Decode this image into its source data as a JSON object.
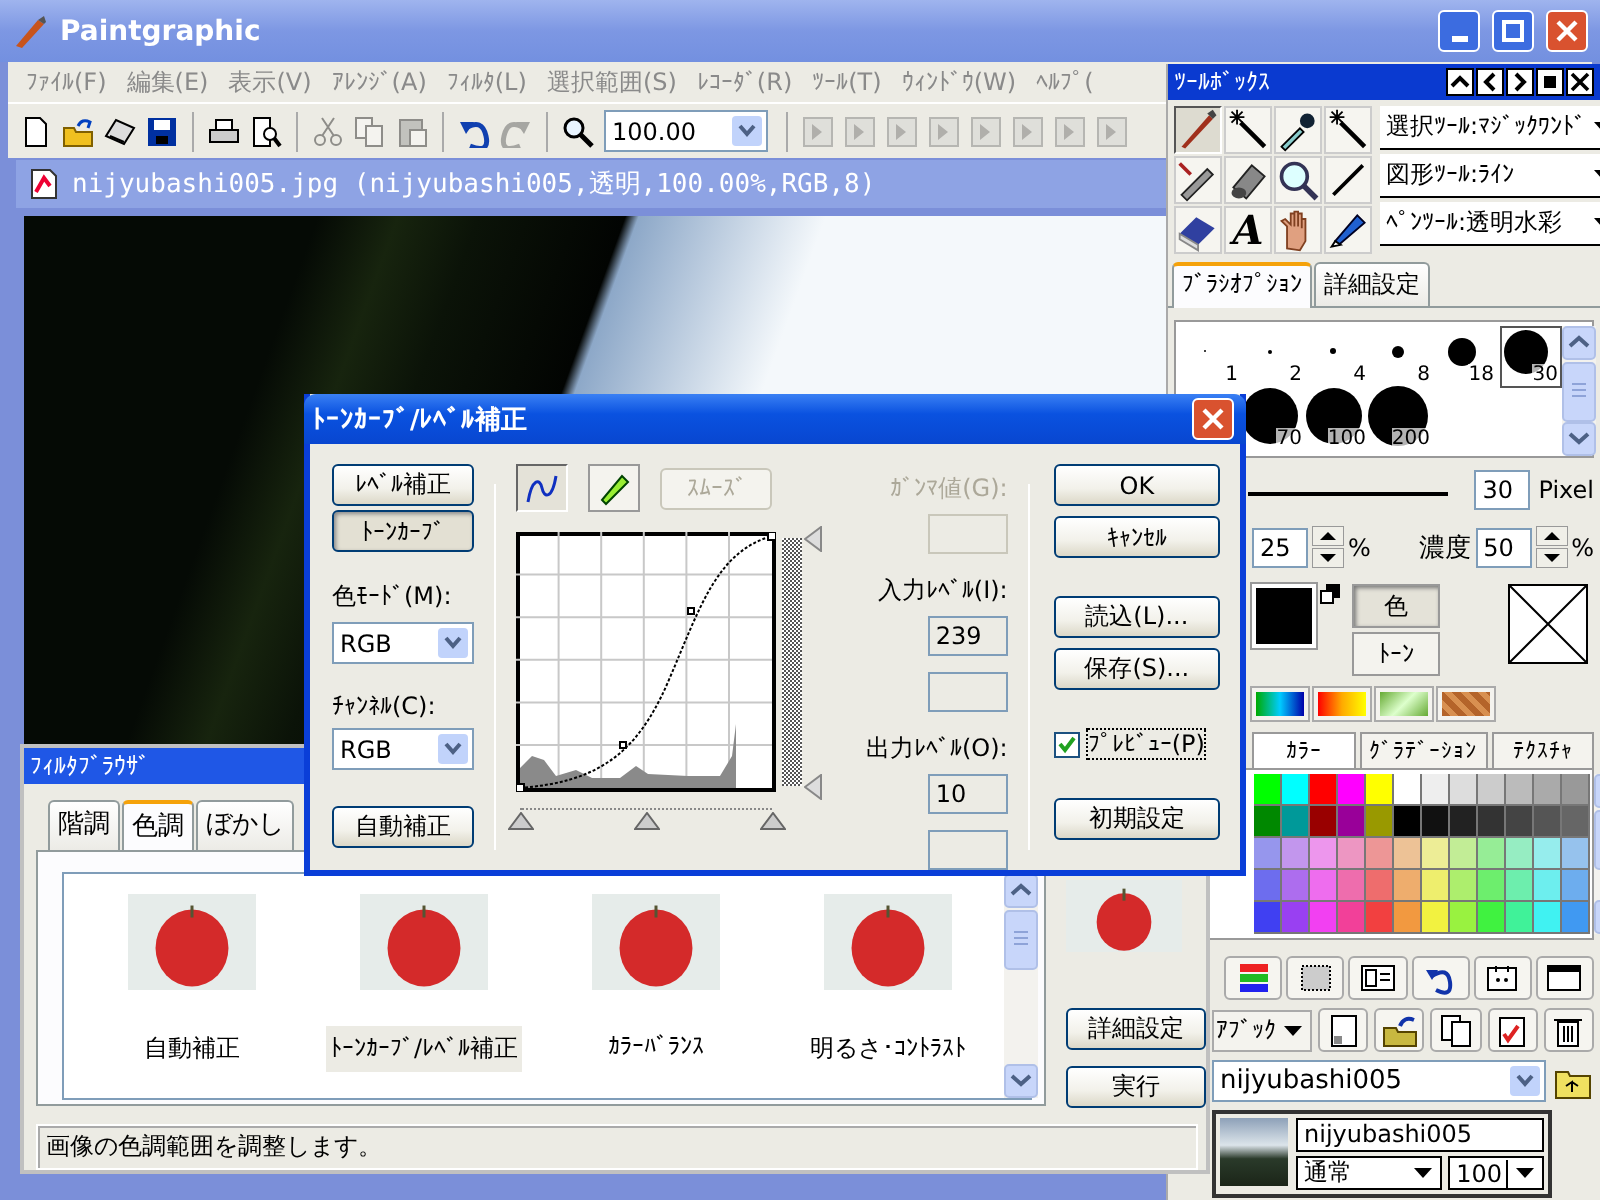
{
  "app": {
    "title": "Paintgraphic"
  },
  "menu": [
    "ﾌｧｲﾙ(F)",
    "編集(E)",
    "表示(V)",
    "ｱﾚﾝｼﾞ(A)",
    "ﾌｨﾙﾀ(L)",
    "選択範囲(S)",
    "ﾚｺｰﾀﾞ(R)",
    "ﾂｰﾙ(T)",
    "ｳｨﾝﾄﾞｳ(W)",
    "ﾍﾙﾌﾟ("
  ],
  "toolbar": {
    "zoom": "100.00",
    "buttons": [
      {
        "kind": "new-file",
        "disabled": false
      },
      {
        "kind": "open-folder",
        "disabled": false
      },
      {
        "kind": "scanner",
        "disabled": false
      },
      {
        "kind": "save",
        "disabled": false
      },
      {
        "kind": "sep"
      },
      {
        "kind": "printer",
        "disabled": false
      },
      {
        "kind": "print-preview",
        "disabled": false
      },
      {
        "kind": "sep"
      },
      {
        "kind": "scissors",
        "disabled": true
      },
      {
        "kind": "copy",
        "disabled": true
      },
      {
        "kind": "paste",
        "disabled": true
      },
      {
        "kind": "sep"
      },
      {
        "kind": "undo",
        "disabled": false
      },
      {
        "kind": "redo",
        "disabled": true
      },
      {
        "kind": "sep"
      },
      {
        "kind": "magnifier",
        "disabled": false
      },
      {
        "kind": "zoom"
      },
      {
        "kind": "sep"
      },
      {
        "kind": "arrange",
        "disabled": true
      },
      {
        "kind": "arrange",
        "disabled": true
      },
      {
        "kind": "arrange",
        "disabled": true
      },
      {
        "kind": "arrange",
        "disabled": true
      },
      {
        "kind": "arrange",
        "disabled": true
      },
      {
        "kind": "arrange",
        "disabled": true
      },
      {
        "kind": "arrange",
        "disabled": true
      },
      {
        "kind": "arrange",
        "disabled": true
      }
    ]
  },
  "document": {
    "title": "nijyubashi005.jpg (nijyubashi005,透明,100.00%,RGB,8)"
  },
  "toolbox": {
    "title": "ﾂｰﾙﾎﾞｯｸｽ",
    "tools": [
      {
        "kind": "brush",
        "selected": true
      },
      {
        "kind": "wand",
        "selected": false
      },
      {
        "kind": "dropper",
        "selected": false
      },
      {
        "kind": "wand",
        "selected": false
      },
      {
        "kind": "airbrush",
        "selected": false
      },
      {
        "kind": "roller",
        "selected": false
      },
      {
        "kind": "magnifier",
        "selected": false
      },
      {
        "kind": "line",
        "selected": false
      },
      {
        "kind": "eraser",
        "selected": false
      },
      {
        "kind": "text",
        "glyph": "A",
        "selected": false
      },
      {
        "kind": "hand",
        "selected": false
      },
      {
        "kind": "marker",
        "selected": false
      }
    ],
    "tool_selects": [
      "選択ﾂｰﾙ:ﾏｼﾞｯｸﾜﾝﾄﾞ",
      "図形ﾂｰﾙ:ﾗｲﾝ",
      "ﾍﾟﾝﾂｰﾙ:透明水彩"
    ],
    "tabs": [
      {
        "label": "ﾌﾞﾗｼｵﾌﾟｼｮﾝ",
        "selected": true
      },
      {
        "label": "詳細設定",
        "selected": false
      }
    ],
    "brushes": [
      {
        "size": "1",
        "selected": false
      },
      {
        "size": "2",
        "selected": false
      },
      {
        "size": "4",
        "selected": false
      },
      {
        "size": "8",
        "selected": false
      },
      {
        "size": "18",
        "selected": false
      },
      {
        "size": "30",
        "selected": true
      },
      {
        "size": "70",
        "selected": false
      },
      {
        "size": "100",
        "selected": false
      },
      {
        "size": "200",
        "selected": false
      }
    ],
    "size": {
      "value": "30",
      "unit": "Pixel"
    },
    "opacity": {
      "value": "25",
      "unit": "%"
    },
    "density": {
      "label": "濃度",
      "value": "50",
      "unit": "%"
    },
    "color_buttons": [
      {
        "label": "色",
        "selected": true
      },
      {
        "label": "ﾄｰﾝ",
        "selected": false
      }
    ],
    "color_tabs": [
      {
        "label": "ｶﾗｰ",
        "selected": true
      },
      {
        "label": "ｸﾞﾗﾃﾞｰｼｮﾝ",
        "selected": false
      },
      {
        "label": "ﾃｸｽﾁｬ",
        "selected": false
      }
    ],
    "layer": {
      "mode": "ｱﾌﾞｯｸ",
      "document": "nijyubashi005",
      "name": "nijyubashi005",
      "blend": "通常",
      "opacity": "100"
    }
  },
  "filter_browser": {
    "title": "ﾌｨﾙﾀﾌﾞﾗｳｻﾞ",
    "tabs": [
      {
        "label": "階調",
        "selected": false
      },
      {
        "label": "色調",
        "selected": true
      },
      {
        "label": "ぼかし",
        "selected": false
      }
    ],
    "items": [
      {
        "label": "自動補正",
        "selected": false
      },
      {
        "label": "ﾄｰﾝｶｰﾌﾞ/ﾚﾍﾞﾙ補正",
        "selected": true
      },
      {
        "label": "ｶﾗｰﾊﾞﾗﾝｽ",
        "selected": false
      },
      {
        "label": "明るさ･ｺﾝﾄﾗｽﾄ",
        "selected": false
      }
    ],
    "buttons": [
      "詳細設定",
      "実行"
    ],
    "status": "画像の色調範囲を調整します。"
  },
  "dialog": {
    "title": "ﾄｰﾝｶｰﾌﾞ/ﾚﾍﾞﾙ補正",
    "modes": [
      {
        "label": "ﾚﾍﾞﾙ補正",
        "selected": false
      },
      {
        "label": "ﾄｰﾝｶｰﾌﾞ",
        "selected": true
      }
    ],
    "color_mode": {
      "label": "色ﾓｰﾄﾞ(M):",
      "value": "RGB"
    },
    "channel": {
      "label": "ﾁｬﾝﾈﾙ(C):",
      "value": "RGB"
    },
    "auto_button": "自動補正",
    "curve_tools": [
      {
        "kind": "curve",
        "selected": true
      },
      {
        "kind": "pencil",
        "selected": false
      }
    ],
    "smooth": {
      "label": "ｽﾑｰｽﾞ",
      "disabled": true
    },
    "gamma": {
      "label": "ｶﾞﾝﾏ値(G):",
      "disabled": true
    },
    "input_level": {
      "label": "入力ﾚﾍﾞﾙ(I):",
      "value": "239"
    },
    "output_level": {
      "label": "出力ﾚﾍﾞﾙ(O):",
      "value": "10"
    },
    "output_handles": [
      {
        "level": 1
      },
      {
        "level": 0
      }
    ],
    "input_handles": [
      {
        "level": 0
      },
      {
        "level": 0.5
      },
      {
        "level": 1
      }
    ],
    "buttons": [
      "OK",
      "ｷｬﾝｾﾙ",
      "読込(L)...",
      "保存(S)..."
    ],
    "preview": {
      "label": "ﾌﾟﾚﾋﾞｭｰ(P)",
      "checked": true
    },
    "reset_button": "初期設定"
  }
}
